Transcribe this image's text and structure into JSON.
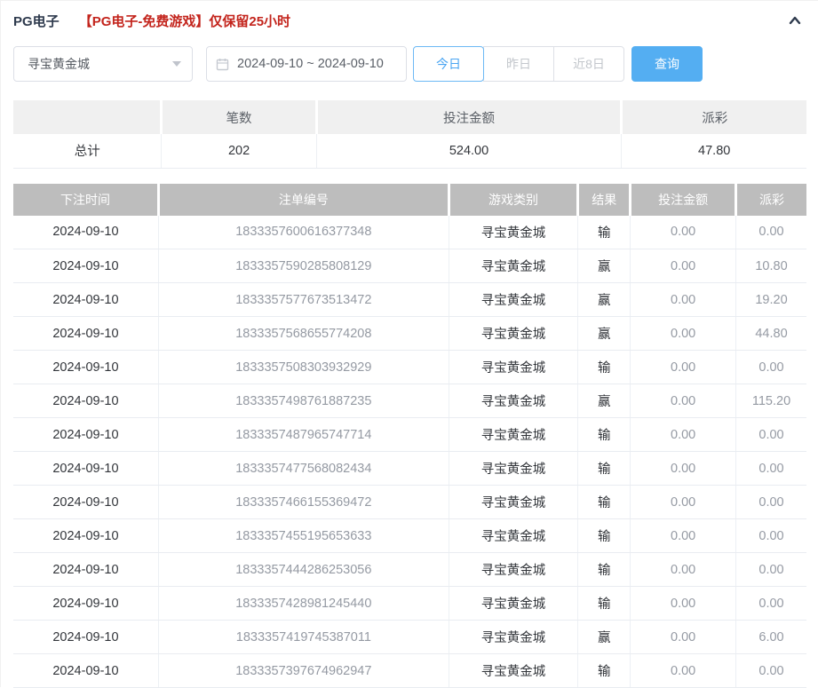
{
  "panel": {
    "title": "PG电子",
    "notice": "【PG电子-免费游戏】仅保留25小时"
  },
  "filters": {
    "game_select": {
      "value": "寻宝黄金城",
      "icon": "chevron-down-icon"
    },
    "date_range": {
      "value": "2024-09-10 ~ 2024-09-10",
      "icon": "calendar-icon"
    },
    "quick_buttons": [
      {
        "label": "今日",
        "active": true
      },
      {
        "label": "昨日",
        "active": false
      },
      {
        "label": "近8日",
        "active": false
      }
    ],
    "search_label": "查询"
  },
  "summary": {
    "headers": {
      "label": "",
      "count": "笔数",
      "amount": "投注金额",
      "payout": "派彩"
    },
    "row_label": "总计",
    "count": "202",
    "amount": "524.00",
    "payout": "47.80"
  },
  "table": {
    "headers": {
      "time": "下注时间",
      "order": "注单编号",
      "game": "游戏类别",
      "result": "结果",
      "bet": "投注金额",
      "payout": "派彩"
    },
    "rows": [
      [
        "2024-09-10",
        "1833357600616377348",
        "寻宝黄金城",
        "输",
        "0.00",
        "0.00"
      ],
      [
        "2024-09-10",
        "1833357590285808129",
        "寻宝黄金城",
        "赢",
        "0.00",
        "10.80"
      ],
      [
        "2024-09-10",
        "1833357577673513472",
        "寻宝黄金城",
        "赢",
        "0.00",
        "19.20"
      ],
      [
        "2024-09-10",
        "1833357568655774208",
        "寻宝黄金城",
        "赢",
        "0.00",
        "44.80"
      ],
      [
        "2024-09-10",
        "1833357508303932929",
        "寻宝黄金城",
        "输",
        "0.00",
        "0.00"
      ],
      [
        "2024-09-10",
        "1833357498761887235",
        "寻宝黄金城",
        "赢",
        "0.00",
        "115.20"
      ],
      [
        "2024-09-10",
        "1833357487965747714",
        "寻宝黄金城",
        "输",
        "0.00",
        "0.00"
      ],
      [
        "2024-09-10",
        "1833357477568082434",
        "寻宝黄金城",
        "输",
        "0.00",
        "0.00"
      ],
      [
        "2024-09-10",
        "1833357466155369472",
        "寻宝黄金城",
        "输",
        "0.00",
        "0.00"
      ],
      [
        "2024-09-10",
        "1833357455195653633",
        "寻宝黄金城",
        "输",
        "0.00",
        "0.00"
      ],
      [
        "2024-09-10",
        "1833357444286253056",
        "寻宝黄金城",
        "输",
        "0.00",
        "0.00"
      ],
      [
        "2024-09-10",
        "1833357428981245440",
        "寻宝黄金城",
        "输",
        "0.00",
        "0.00"
      ],
      [
        "2024-09-10",
        "1833357419745387011",
        "寻宝黄金城",
        "赢",
        "0.00",
        "6.00"
      ],
      [
        "2024-09-10",
        "1833357397674962947",
        "寻宝黄金城",
        "输",
        "0.00",
        "0.00"
      ]
    ]
  },
  "colors": {
    "accent_red": "#c3241c",
    "accent_blue": "#54aef2",
    "active_tab_blue": "#4aa5f2",
    "table_header_gray": "#bdbdbd",
    "summary_header_gray": "#f0f0f0",
    "title_navy": "#2e3a4d",
    "muted_text_gray": "#959aa3"
  }
}
